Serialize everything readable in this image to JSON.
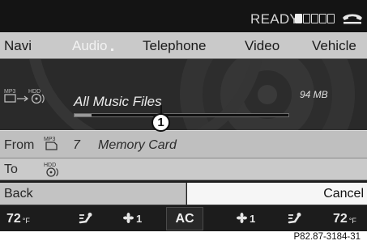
{
  "status": {
    "text": "READY",
    "signal_bars_filled": 1,
    "signal_bars_total": 5,
    "phone_icon": "phone-handset-icon"
  },
  "menu": {
    "items": [
      "Navi",
      "Audio",
      "Telephone",
      "Video",
      "Vehicle"
    ],
    "active": "Audio"
  },
  "media": {
    "source_icon": "mp3-to-hdd-copy-icon",
    "folder_name": "All Music Files",
    "file_size": "94 MB",
    "progress_fraction": 0.08,
    "callout": "1"
  },
  "copy": {
    "from_label": "From",
    "from_icon": "mp3-card-icon",
    "from_number": "7",
    "from_name": "Memory Card",
    "to_label": "To",
    "to_icon": "hdd-icon"
  },
  "actions": {
    "back_label": "Back",
    "cancel_label": "Cancel"
  },
  "climate": {
    "left_temp": "72",
    "right_temp": "72",
    "unit": "°F",
    "left_fan": "1",
    "right_fan": "1",
    "ac_label": "AC"
  },
  "caption": "P82.87-3184-31",
  "colors": {
    "screen_bg": "#1f1f1f",
    "menu_bg": "#c9c9c9",
    "cancel_bg": "#f6f6f6"
  }
}
